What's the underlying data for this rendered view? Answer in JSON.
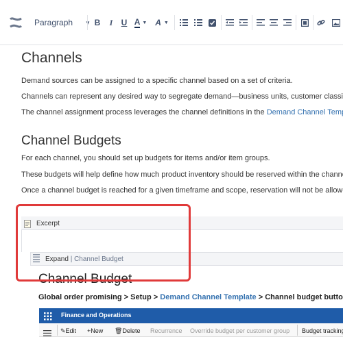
{
  "toolbar": {
    "paragraph_label": "Paragraph"
  },
  "page": {
    "heading_channels": "Channels",
    "p1": "Demand sources can be assigned to a specific channel based on a set of criteria.",
    "p2": "Channels can represent any desired way to segregate demand—business units, customer classifica",
    "p3_text": "The channel assignment process leverages the channel definitions in the ",
    "p3_link": "Demand Channel Templa",
    "heading_budgets": "Channel Budgets",
    "p4": "For each channel, you should set up budgets for items and/or item groups.",
    "p5": "These budgets will help define how much product inventory should be reserved within the channel.",
    "p6": "Once a channel budget is reached for a given timeframe and scope, reservation will not be allowed"
  },
  "excerpt": {
    "label": "Excerpt"
  },
  "expand": {
    "label": "Expand",
    "separator": " | ",
    "sub": "Channel Budget"
  },
  "channel_budget": {
    "title": "Channel Budget",
    "path_start": "Global order promising > Setup > ",
    "path_link": "Demand Channel Template",
    "path_end": " > Channel budget button"
  },
  "fo": {
    "app_title": "Finance and Operations",
    "actions": {
      "edit": "Edit",
      "new": "New",
      "delete": "Delete",
      "recurrence": "Recurrence",
      "override": "Override budget per customer group",
      "tracking": "Budget tracking"
    }
  },
  "colors": {
    "link": "#3572b0",
    "annotation": "#e03a3a",
    "fo_bar": "#1f5ca9"
  }
}
